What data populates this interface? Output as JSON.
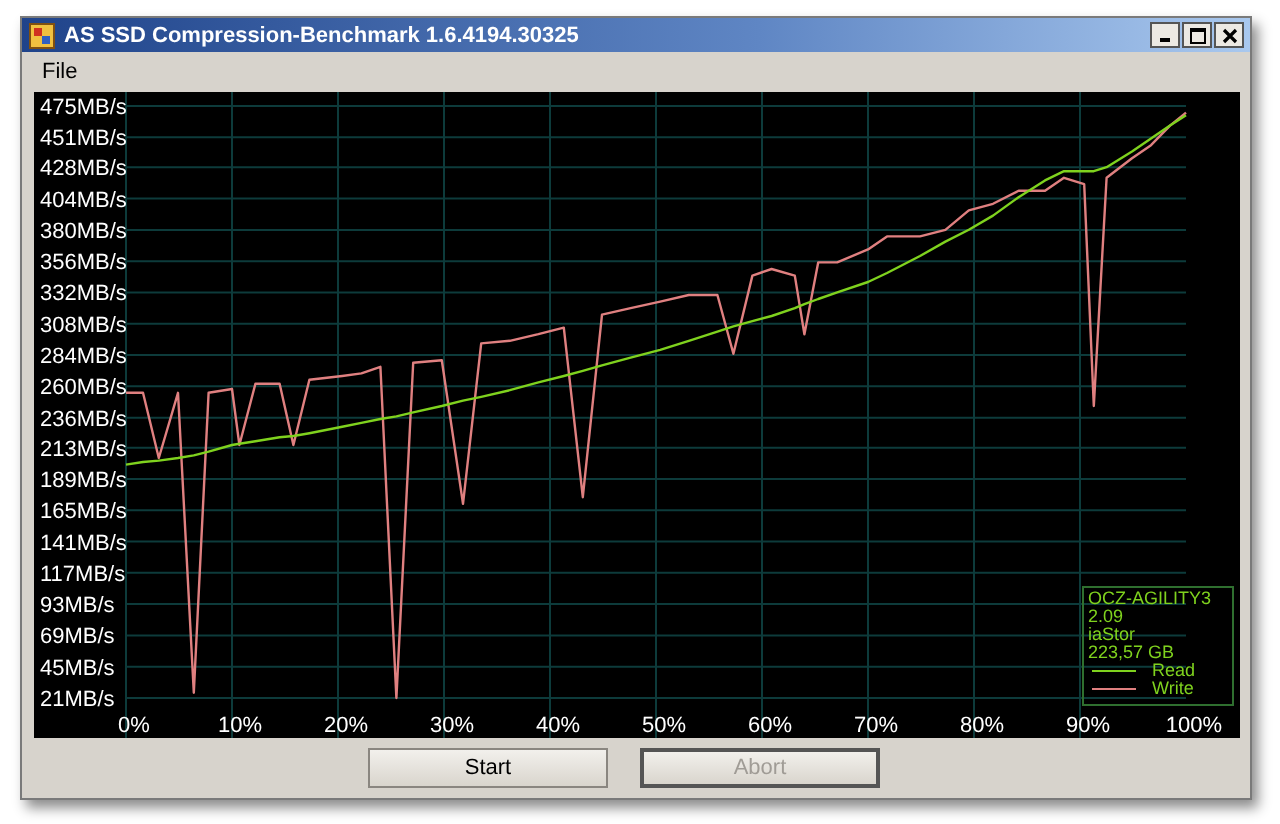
{
  "window": {
    "title": "AS SSD Compression-Benchmark 1.6.4194.30325"
  },
  "menu": [
    "File"
  ],
  "chart": {
    "chart_data": {
      "type": "line",
      "x": [
        0,
        1.6,
        3.1,
        4.9,
        6.4,
        7.8,
        10,
        10.7,
        12.2,
        14.5,
        15.8,
        17.3,
        20.4,
        22.2,
        24,
        25.5,
        27.1,
        29.8,
        31.8,
        33.5,
        36.2,
        38.9,
        41.3,
        43.1,
        44.9,
        47.6,
        50.4,
        53.1,
        55.8,
        57.3,
        59.1,
        60.9,
        63.1,
        64,
        65.3,
        67.1,
        70,
        71.8,
        74.9,
        77.3,
        79.5,
        81.8,
        84.2,
        86.7,
        88.5,
        90.4,
        91.3,
        92.5,
        94.9,
        96.7,
        98.5,
        100
      ],
      "series": [
        {
          "name": "Read",
          "color": "#7fd21e",
          "values": [
            200,
            202,
            203,
            205,
            207,
            210,
            215,
            216,
            218,
            221,
            222,
            224,
            229,
            232,
            235,
            237,
            240,
            245,
            249,
            252,
            257,
            263,
            268,
            272,
            276,
            282,
            288,
            295,
            302,
            306,
            310,
            314,
            320,
            323,
            327,
            332,
            340,
            347,
            360,
            371,
            380,
            391,
            405,
            418,
            425,
            425,
            425,
            428,
            440,
            450,
            460,
            468
          ]
        },
        {
          "name": "Write",
          "color": "#e08080",
          "values": [
            255,
            255,
            205,
            255,
            25,
            255,
            258,
            215,
            262,
            262,
            215,
            265,
            268,
            270,
            275,
            21,
            278,
            280,
            170,
            293,
            295,
            300,
            305,
            175,
            315,
            320,
            325,
            330,
            330,
            285,
            345,
            350,
            345,
            300,
            355,
            355,
            365,
            375,
            375,
            380,
            395,
            400,
            410,
            410,
            420,
            415,
            245,
            420,
            435,
            445,
            460,
            470
          ]
        }
      ],
      "grid": true,
      "xlim": [
        0,
        100
      ],
      "ylim": [
        21,
        475
      ],
      "xticks": [
        {
          "value": 0,
          "label": "0%"
        },
        {
          "value": 10,
          "label": "10%"
        },
        {
          "value": 20,
          "label": "20%"
        },
        {
          "value": 30,
          "label": "30%"
        },
        {
          "value": 40,
          "label": "40%"
        },
        {
          "value": 50,
          "label": "50%"
        },
        {
          "value": 60,
          "label": "60%"
        },
        {
          "value": 70,
          "label": "70%"
        },
        {
          "value": 80,
          "label": "80%"
        },
        {
          "value": 90,
          "label": "90%"
        },
        {
          "value": 100,
          "label": "100%"
        }
      ],
      "yticks": [
        {
          "value": 475,
          "label": "475MB/s"
        },
        {
          "value": 451,
          "label": "451MB/s"
        },
        {
          "value": 428,
          "label": "428MB/s"
        },
        {
          "value": 404,
          "label": "404MB/s"
        },
        {
          "value": 380,
          "label": "380MB/s"
        },
        {
          "value": 356,
          "label": "356MB/s"
        },
        {
          "value": 332,
          "label": "332MB/s"
        },
        {
          "value": 308,
          "label": "308MB/s"
        },
        {
          "value": 284,
          "label": "284MB/s"
        },
        {
          "value": 260,
          "label": "260MB/s"
        },
        {
          "value": 236,
          "label": "236MB/s"
        },
        {
          "value": 213,
          "label": "213MB/s"
        },
        {
          "value": 189,
          "label": "189MB/s"
        },
        {
          "value": 165,
          "label": "165MB/s"
        },
        {
          "value": 141,
          "label": "141MB/s"
        },
        {
          "value": 117,
          "label": "117MB/s"
        },
        {
          "value": 93,
          "label": "93MB/s"
        },
        {
          "value": 69,
          "label": "69MB/s"
        },
        {
          "value": 45,
          "label": "45MB/s"
        },
        {
          "value": 21,
          "label": "21MB/s"
        }
      ]
    },
    "info": [
      "OCZ-AGILITY3",
      "2.09",
      "iaStor",
      "223,57 GB"
    ]
  },
  "buttons": [
    {
      "label": "Start",
      "disabled": false
    },
    {
      "label": "Abort",
      "disabled": true
    }
  ]
}
